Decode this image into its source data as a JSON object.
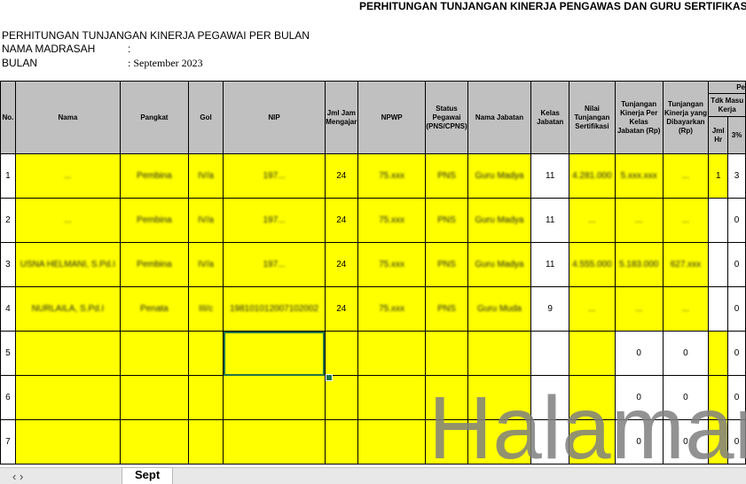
{
  "sheet": {
    "title": "PERHITUNGAN TUNJANGAN KINERJA PENGAWAS DAN GURU SERTIFIKASI PA",
    "subtitle": "PERHITUNGAN TUNJANGAN KINERJA PEGAWAI PER BULAN",
    "madrasah_label": "NAMA MADRASAH",
    "madrasah_colon": ":",
    "bulan_label": "BULAN",
    "bulan_value": ":  September 2023"
  },
  "headers": {
    "no": "No.",
    "nama": "Nama",
    "pangkat": "Pangkat",
    "gol": "Gol",
    "nip": "NIP",
    "jml_jam": "Jml Jam Mengajar",
    "npwp": "NPWP",
    "status": "Status Pegawai (PNS/CPNS)",
    "jabatan": "Nama Jabatan",
    "kelas": "Kelas Jabatan",
    "nilai": "Nilai Tunjangan Sertifikasi",
    "tunj_kelas": "Tunjangan Kinerja Per Kelas Jabatan (Rp)",
    "tunj_bayar": "Tunjangan Kinerja yang Dibayarkan (Rp)",
    "group_top": "Pe",
    "group_sub": "Tdk Masu Kerja",
    "jml_hr": "Jml Hr",
    "pct": "3%"
  },
  "rows": [
    {
      "no": "1",
      "nama": "...",
      "pangkat": "Pembina",
      "gol": "IV/a",
      "nip": "197...",
      "jam": "24",
      "npwp": "75.xxx",
      "status": "PNS",
      "jabatan": "Guru Madya",
      "kelas": "11",
      "nilai": "4.281.000",
      "tunj_kelas": "5.xxx.xxx",
      "tunj_bayar": "...",
      "jml_hr": "1",
      "pct": "3"
    },
    {
      "no": "2",
      "nama": "...",
      "pangkat": "Pembina",
      "gol": "IV/a",
      "nip": "197...",
      "jam": "24",
      "npwp": "75.xxx",
      "status": "PNS",
      "jabatan": "Guru Madya",
      "kelas": "11",
      "nilai": "...",
      "tunj_kelas": "...",
      "tunj_bayar": "...",
      "jml_hr": "",
      "pct": "0"
    },
    {
      "no": "3",
      "nama": "USNA HELMANI, S.Pd.I",
      "pangkat": "Pembina",
      "gol": "IV/a",
      "nip": "197...",
      "jam": "24",
      "npwp": "75.xxx",
      "status": "PNS",
      "jabatan": "Guru Madya",
      "kelas": "11",
      "nilai": "4.555.000",
      "tunj_kelas": "5.183.000",
      "tunj_bayar": "627.xxx",
      "jml_hr": "",
      "pct": "0"
    },
    {
      "no": "4",
      "nama": "NURLAILA, S.Pd.I",
      "pangkat": "Penata",
      "gol": "III/c",
      "nip": "198101012007102002",
      "jam": "24",
      "npwp": "75.xxx",
      "status": "PNS",
      "jabatan": "Guru Muda",
      "kelas": "9",
      "nilai": "...",
      "tunj_kelas": "...",
      "tunj_bayar": "...",
      "jml_hr": "",
      "pct": "0"
    },
    {
      "no": "5",
      "nama": "",
      "pangkat": "",
      "gol": "",
      "nip": "",
      "jam": "",
      "npwp": "",
      "status": "",
      "jabatan": "",
      "kelas": "",
      "nilai": "",
      "tunj_kelas": "0",
      "tunj_bayar": "0",
      "jml_hr": "",
      "pct": "0"
    },
    {
      "no": "6",
      "nama": "",
      "pangkat": "",
      "gol": "",
      "nip": "",
      "jam": "",
      "npwp": "",
      "status": "",
      "jabatan": "",
      "kelas": "",
      "nilai": "",
      "tunj_kelas": "0",
      "tunj_bayar": "0",
      "jml_hr": "",
      "pct": "0"
    },
    {
      "no": "7",
      "nama": "",
      "pangkat": "",
      "gol": "",
      "nip": "",
      "jam": "",
      "npwp": "",
      "status": "",
      "jabatan": "",
      "kelas": "",
      "nilai": "",
      "tunj_kelas": "0",
      "tunj_bayar": "0",
      "jml_hr": "",
      "pct": "0"
    }
  ],
  "watermark": "Halaman",
  "tabs": {
    "active": "Sept"
  },
  "colors": {
    "highlight": "#ffff00",
    "header": "#c0c0c0",
    "selection": "#217346"
  }
}
